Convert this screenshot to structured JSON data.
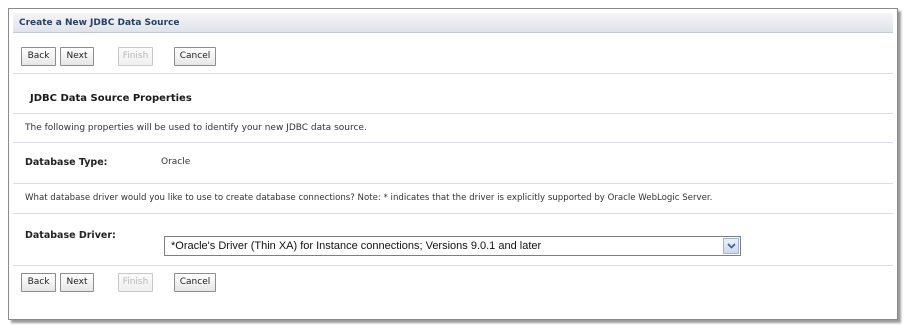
{
  "panel": {
    "title": "Create a New JDBC Data Source"
  },
  "buttons": {
    "back": "Back",
    "next": "Next",
    "finish": "Finish",
    "cancel": "Cancel"
  },
  "section": {
    "title": "JDBC Data Source Properties",
    "description": "The following properties will be used to identify your new JDBC data source."
  },
  "database_type": {
    "label": "Database Type:",
    "value": "Oracle"
  },
  "driver_note": "What database driver would you like to use to create database connections? Note: * indicates that the driver is explicitly supported by Oracle WebLogic Server.",
  "database_driver": {
    "label": "Database Driver:",
    "selected": "*Oracle's Driver (Thin XA) for Instance connections; Versions 9.0.1 and later",
    "arrow_icon": "chevron-down-icon"
  },
  "colors": {
    "header_text": "#2b3f60",
    "dropdown_arrow": "#3a5a9c"
  }
}
